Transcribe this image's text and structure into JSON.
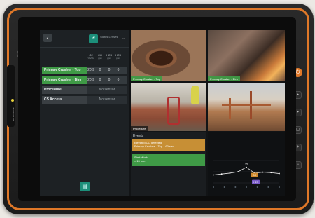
{
  "header": {
    "back_icon": "arrow-left-icon",
    "app_name": "Status Lenses",
    "logo_icon": "site-logo-icon"
  },
  "gas_columns": [
    {
      "name": "O2",
      "unit": "%VOL"
    },
    {
      "name": "CO",
      "unit": "ppm"
    },
    {
      "name": "H2S",
      "unit": "ppm"
    },
    {
      "name": "H2S",
      "unit": "ppm"
    }
  ],
  "locations": [
    {
      "name": "Primary Crusher - Top",
      "status": "green",
      "values": [
        "20.9",
        "0",
        "0",
        "0"
      ]
    },
    {
      "name": "Primary Crusher - Btm",
      "status": "green",
      "values": [
        "20.9",
        "0",
        "0",
        "0"
      ]
    },
    {
      "name": "Procedure",
      "status": "grey",
      "no_sensor": "No sensor"
    },
    {
      "name": "CS Access",
      "status": "grey",
      "no_sensor": "No sensor"
    }
  ],
  "videos": [
    {
      "label": "Primary Crusher - Top"
    },
    {
      "label": "Primary Crusher - Btm"
    },
    {
      "label": "Procedure"
    },
    {
      "label": ""
    }
  ],
  "events": {
    "title": "Events",
    "items": [
      {
        "type": "amber",
        "line1": "Elevated CO detected",
        "line2": "Primary Crusher – Top – 60 sec"
      },
      {
        "type": "green",
        "line1": "Start Work",
        "line2": "– 15 min"
      }
    ]
  },
  "chart_data": {
    "type": "line",
    "values": [
      18,
      20,
      22,
      25,
      35,
      22,
      24,
      23,
      21
    ],
    "data_label": "35",
    "tags": [
      "CO",
      "H2S"
    ],
    "tag_colors": [
      "#d08a2e",
      "#7a5bc8"
    ],
    "ylim": [
      0,
      50
    ]
  },
  "colors": {
    "accent_orange": "#e07828",
    "status_green": "#3f9a46",
    "alert_amber": "#c78f35",
    "teal": "#1c8f7a"
  },
  "device": {
    "brand": "ECHOSAFE",
    "power_icon": "power-icon"
  }
}
